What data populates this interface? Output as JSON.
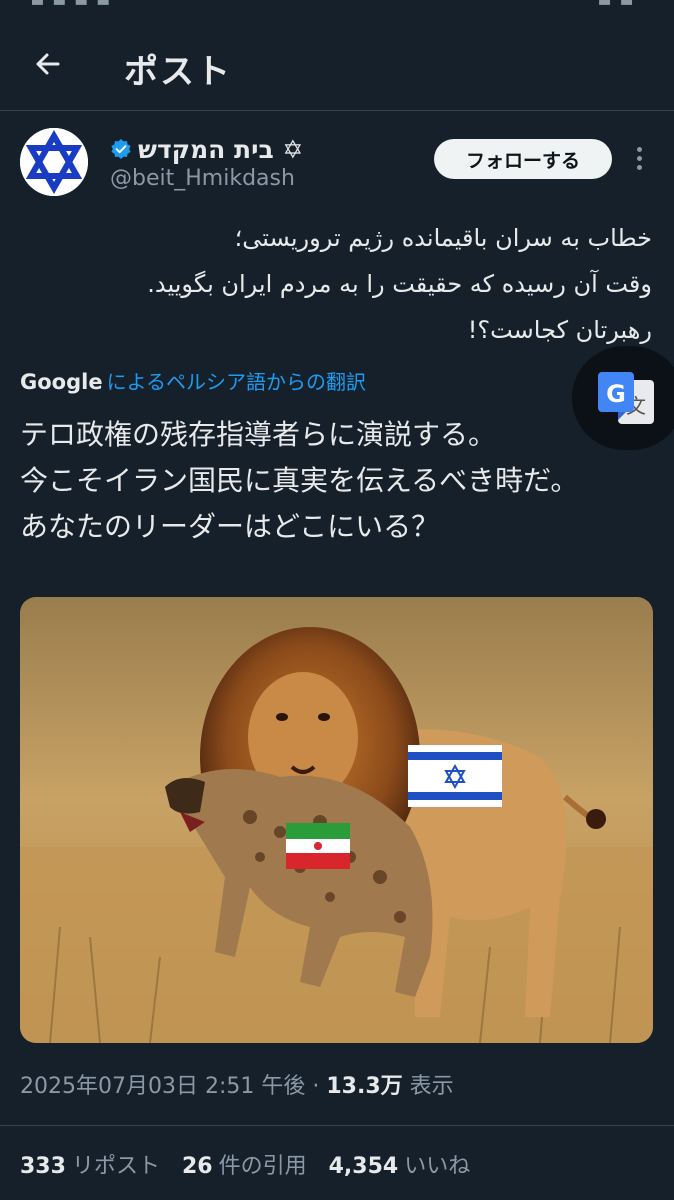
{
  "header": {
    "title": "ポスト"
  },
  "author": {
    "display_name": "בית המקדש ✡",
    "handle": "@beit_Hmikdash",
    "verified": true
  },
  "follow_label": "フォローする",
  "post": {
    "original_lines": [
      "خطاب به سران باقیمانده رژیم تروریستی؛",
      "وقت آن رسیده که حقیقت را به مردم ایران بگویید.",
      "رهبرتان کجاست؟!"
    ],
    "translation_label": {
      "google": "Google",
      "link": "によるペルシア語からの翻訳"
    },
    "translated_lines": [
      "テロ政権の残存指導者らに演説する。",
      "今こそイラン国民に真実を伝えるべき時だ。",
      "あなたのリーダーはどこにいる？"
    ],
    "timestamp": "2025年07月03日 2:51 午後",
    "separator": " · ",
    "views": "13.3万",
    "views_label": " 表示"
  },
  "stats": {
    "reposts": "333",
    "reposts_label": "リポスト",
    "quotes": "26",
    "quotes_label": "件の引用",
    "likes": "4,354",
    "likes_label": "いいね"
  },
  "icons": {
    "back": "arrow-left-icon",
    "verified": "verified-badge-icon",
    "more": "more-vertical-icon",
    "translate": "google-translate-icon"
  },
  "colors": {
    "background": "#15202b",
    "accent": "#1d9bf0",
    "text": "#e7e9ea",
    "muted": "#8b98a5"
  }
}
